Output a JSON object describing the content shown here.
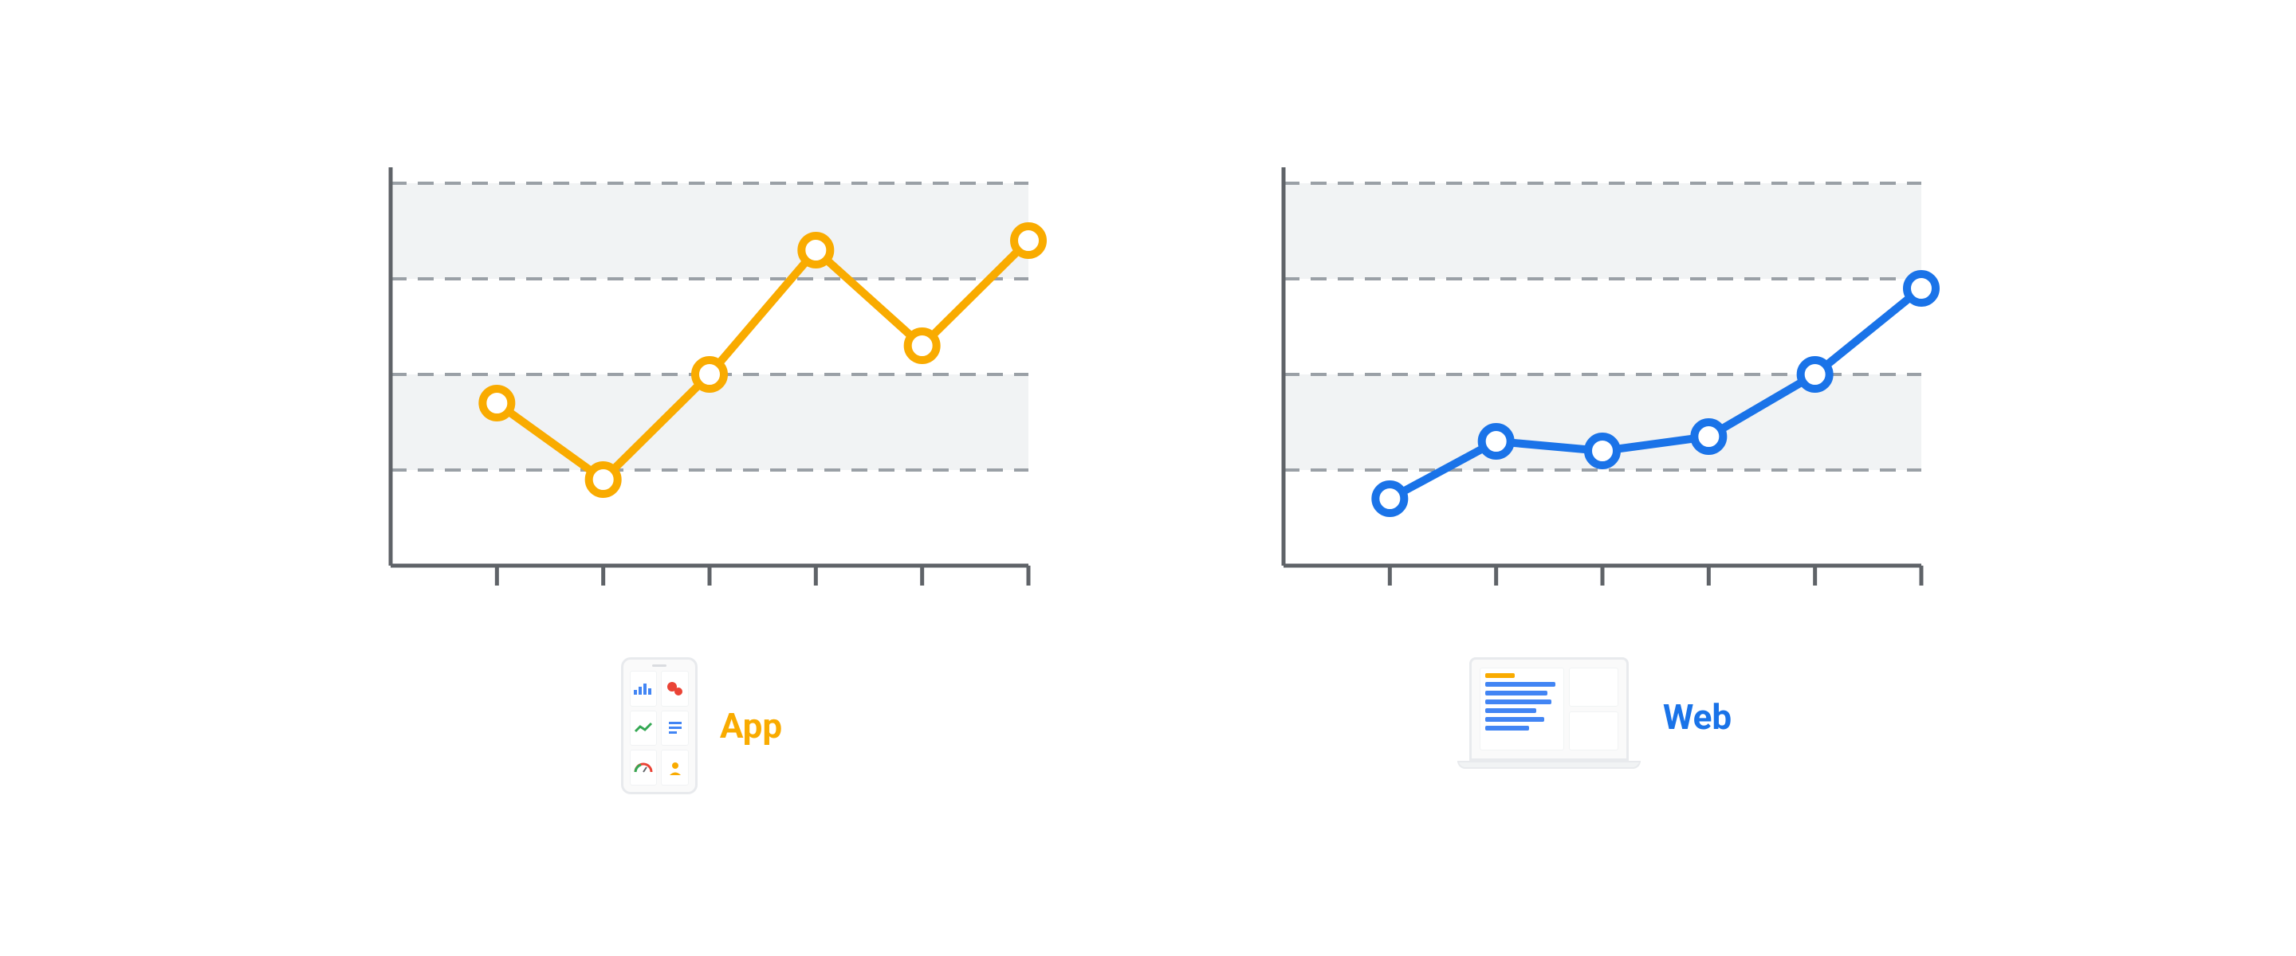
{
  "chart_data": [
    {
      "type": "line",
      "label": "App",
      "color": "#f9ab00",
      "x": [
        1,
        2,
        3,
        4,
        5,
        6
      ],
      "values": [
        1.7,
        0.9,
        2.0,
        3.3,
        2.3,
        3.4
      ],
      "ylim": [
        0,
        4
      ],
      "gridlines_y": [
        1,
        2,
        3,
        4
      ],
      "xlabel": "",
      "ylabel": "",
      "title": ""
    },
    {
      "type": "line",
      "label": "Web",
      "color": "#1a73e8",
      "x": [
        1,
        2,
        3,
        4,
        5,
        6
      ],
      "values": [
        0.7,
        1.3,
        1.2,
        1.35,
        2.0,
        2.9
      ],
      "ylim": [
        0,
        4
      ],
      "gridlines_y": [
        1,
        2,
        3,
        4
      ],
      "xlabel": "",
      "ylabel": "",
      "title": ""
    }
  ],
  "legend": {
    "app_label": "App",
    "web_label": "Web"
  },
  "colors": {
    "app": "#f9ab00",
    "web": "#1a73e8",
    "axis": "#5f6368",
    "grid": "#9aa0a6",
    "band": "#f1f3f4",
    "point_fill": "#ffffff"
  }
}
